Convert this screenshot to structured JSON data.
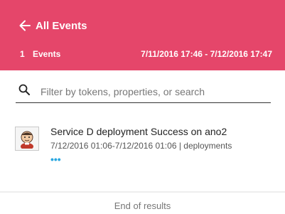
{
  "header": {
    "back_label": "All Events",
    "count": "1",
    "count_label": "Events",
    "time_range": "7/11/2016 17:46 - 7/12/2016 17:47",
    "background_color": "#e5466a"
  },
  "search": {
    "placeholder": "Filter by tokens, properties, or search",
    "value": "",
    "icon": "search-icon"
  },
  "events": [
    {
      "title": "Service D deployment Success on ano2",
      "meta": "7/12/2016 01:06-7/12/2016 01:06 | deployments",
      "more": "•••",
      "avatar_icon": "jenkins-avatar-icon"
    }
  ],
  "footer": {
    "text": "End of results"
  },
  "accent_color": "#2aa7e0"
}
